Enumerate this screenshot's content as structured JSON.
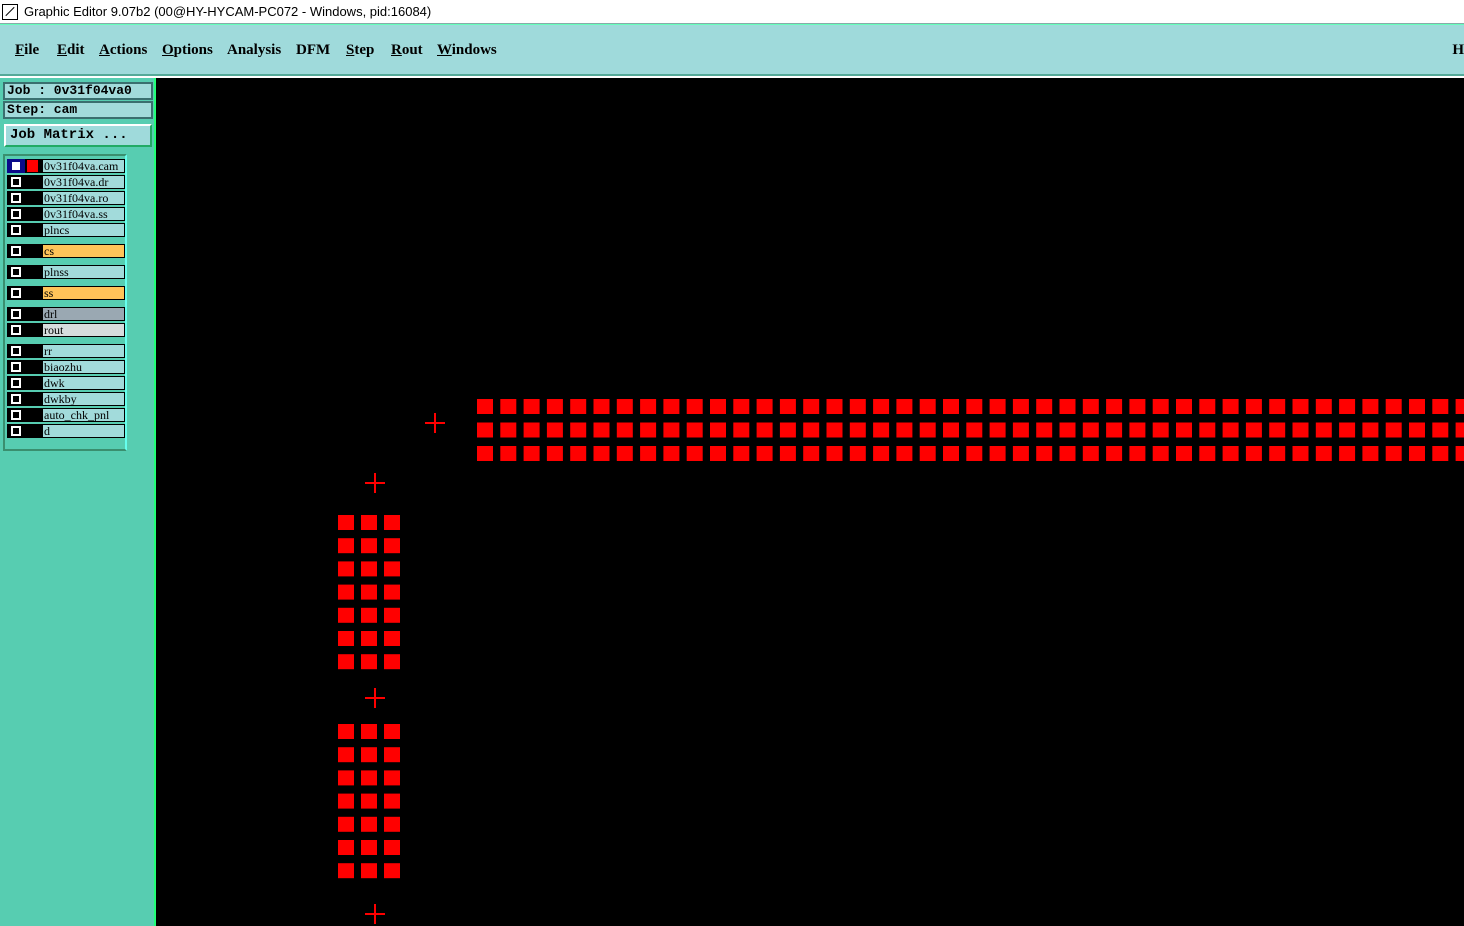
{
  "window": {
    "title": "Graphic Editor 9.07b2 (00@HY-HYCAM-PC072 - Windows, pid:16084)"
  },
  "menu": {
    "file": "File",
    "edit": "Edit",
    "actions": "Actions",
    "options": "Options",
    "analysis": "Analysis",
    "dfm": "DFM",
    "step": "Step",
    "rout": "Rout",
    "windows": "Windows",
    "overflow": "H"
  },
  "panel": {
    "job": "Job : 0v31f04va0",
    "step": "Step: cam",
    "job_matrix": "Job Matrix ...",
    "layers": [
      {
        "name": "0v31f04va.cam",
        "style": "normal",
        "active": true,
        "color": "#ff0000"
      },
      {
        "name": "0v31f04va.dr",
        "style": "normal"
      },
      {
        "name": "0v31f04va.ro",
        "style": "normal"
      },
      {
        "name": "0v31f04va.ss",
        "style": "normal"
      },
      {
        "name": "plncs",
        "style": "normal"
      },
      {
        "name": "cs",
        "style": "orange"
      },
      {
        "name": "plnss",
        "style": "normal"
      },
      {
        "name": "ss",
        "style": "orange"
      },
      {
        "name": "drl",
        "style": "grey"
      },
      {
        "name": "rout",
        "style": "lightgrey"
      },
      {
        "name": "rr",
        "style": "normal"
      },
      {
        "name": "biaozhu",
        "style": "normal"
      },
      {
        "name": "dwk",
        "style": "normal"
      },
      {
        "name": "dwkby",
        "style": "normal"
      },
      {
        "name": "auto_chk_pnl",
        "style": "normal"
      },
      {
        "name": "d",
        "style": "normal"
      }
    ]
  },
  "canvas": {
    "background": "#000000",
    "feature_color": "#ff0000",
    "horizontal_pad_strip": {
      "rows": 3,
      "columns": 43
    },
    "vertical_pad_blocks": [
      {
        "rows": 7,
        "columns": 3
      },
      {
        "rows": 7,
        "columns": 3
      }
    ],
    "crosshair_markers": 4
  }
}
